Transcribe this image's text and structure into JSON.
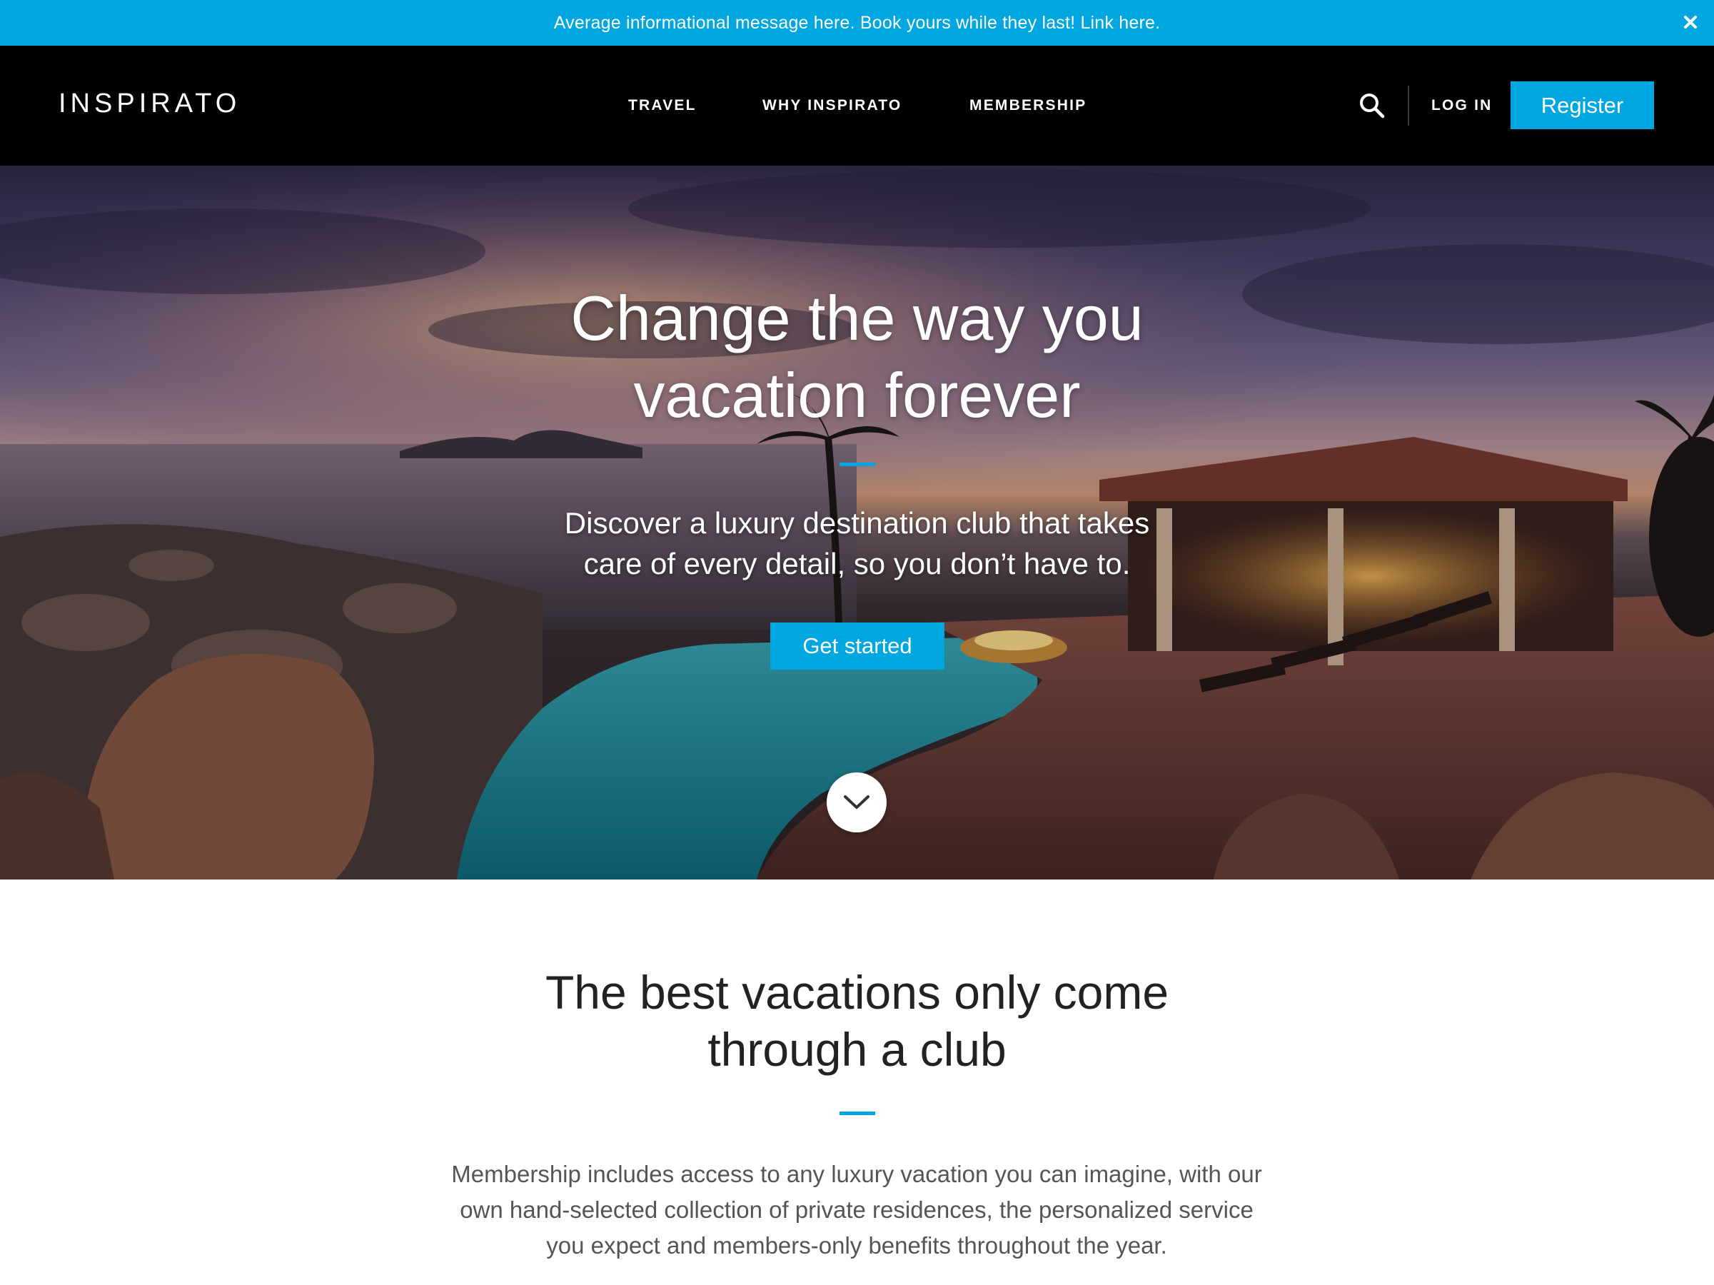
{
  "announcement": {
    "message": "Average informational message here. Book yours while they last! Link here.",
    "close_icon": "close-icon"
  },
  "nav": {
    "logo": "INSPIRATO",
    "links": [
      "TRAVEL",
      "WHY INSPIRATO",
      "MEMBERSHIP"
    ],
    "search_icon": "search-icon",
    "login": "LOG IN",
    "register": "Register"
  },
  "hero": {
    "title_line1": "Change the way you",
    "title_line2": "vacation forever",
    "subtitle_line1": "Discover a luxury destination club that takes",
    "subtitle_line2": "care of every detail, so you don’t have to.",
    "cta": "Get started",
    "scroll_icon": "chevron-down-icon"
  },
  "club": {
    "title_line1": "The best vacations only come",
    "title_line2": "through a club",
    "body_line1": "Membership includes access to any luxury vacation you can imagine, with our",
    "body_line2": "own hand-selected collection of private residences, the personalized service",
    "body_line3": "you expect and members-only benefits throughout the year."
  },
  "colors": {
    "accent": "#00a6e0",
    "nav_background": "#000000",
    "body_text": "#555555"
  }
}
